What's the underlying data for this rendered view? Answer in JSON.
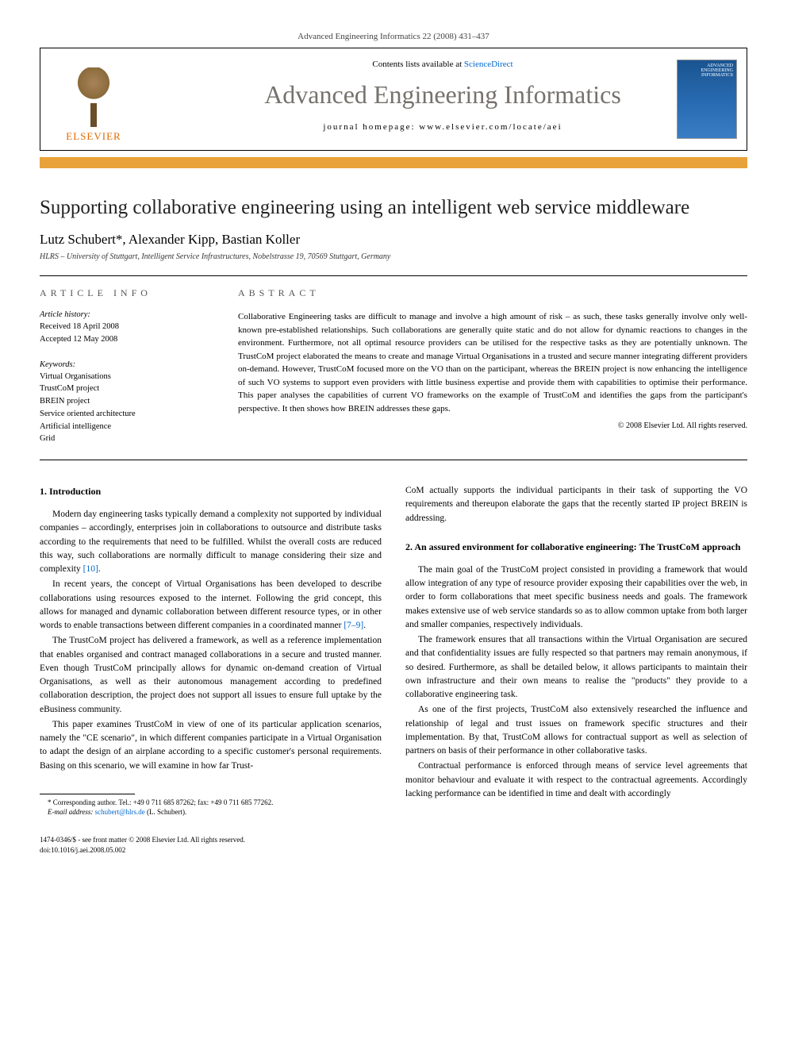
{
  "citation": "Advanced Engineering Informatics 22 (2008) 431–437",
  "header_box": {
    "contents_prefix": "Contents lists available at ",
    "sciencedirect": "ScienceDirect",
    "journal": "Advanced Engineering Informatics",
    "homepage_prefix": "journal homepage: ",
    "homepage_url": "www.elsevier.com/locate/aei",
    "publisher": "ELSEVIER",
    "cover_label": "ADVANCED ENGINEERING INFORMATICS"
  },
  "article": {
    "title": "Supporting collaborative engineering using an intelligent web service middleware",
    "authors": "Lutz Schubert*, Alexander Kipp, Bastian Koller",
    "affiliation": "HLRS – University of Stuttgart, Intelligent Service Infrastructures, Nobelstrasse 19, 70569 Stuttgart, Germany"
  },
  "info": {
    "heading": "ARTICLE INFO",
    "history_label": "Article history:",
    "received": "Received 18 April 2008",
    "accepted": "Accepted 12 May 2008",
    "keywords_label": "Keywords:",
    "keywords": [
      "Virtual Organisations",
      "TrustCoM project",
      "BREIN project",
      "Service oriented architecture",
      "Artificial intelligence",
      "Grid"
    ]
  },
  "abstract": {
    "heading": "ABSTRACT",
    "text": "Collaborative Engineering tasks are difficult to manage and involve a high amount of risk – as such, these tasks generally involve only well-known pre-established relationships. Such collaborations are generally quite static and do not allow for dynamic reactions to changes in the environment. Furthermore, not all optimal resource providers can be utilised for the respective tasks as they are potentially unknown. The TrustCoM project elaborated the means to create and manage Virtual Organisations in a trusted and secure manner integrating different providers on-demand. However, TrustCoM focused more on the VO than on the participant, whereas the BREIN project is now enhancing the intelligence of such VO systems to support even providers with little business expertise and provide them with capabilities to optimise their performance. This paper analyses the capabilities of current VO frameworks on the example of TrustCoM and identifies the gaps from the participant's perspective. It then shows how BREIN addresses these gaps.",
    "copyright": "© 2008 Elsevier Ltd. All rights reserved."
  },
  "sections": {
    "s1": {
      "heading": "1. Introduction",
      "p1a": "Modern day engineering tasks typically demand a complexity not supported by individual companies – accordingly, enterprises join in collaborations to outsource and distribute tasks according to the requirements that need to be fulfilled. Whilst the overall costs are reduced this way, such collaborations are normally difficult to manage considering their size and complexity ",
      "p1_ref": "[10]",
      "p1b": ".",
      "p2a": "In recent years, the concept of Virtual Organisations has been developed to describe collaborations using resources exposed to the internet. Following the grid concept, this allows for managed and dynamic collaboration between different resource types, or in other words to enable transactions between different companies in a coordinated manner ",
      "p2_ref": "[7–9]",
      "p2b": ".",
      "p3": "The TrustCoM project has delivered a framework, as well as a reference implementation that enables organised and contract managed collaborations in a secure and trusted manner. Even though TrustCoM principally allows for dynamic on-demand creation of Virtual Organisations, as well as their autonomous management according to predefined collaboration description, the project does not support all issues to ensure full uptake by the eBusiness community.",
      "p4": "This paper examines TrustCoM in view of one of its particular application scenarios, namely the \"CE scenario\", in which different companies participate in a Virtual Organisation to adapt the design of an airplane according to a specific customer's personal requirements. Basing on this scenario, we will examine in how far Trust-",
      "p4_cont": "CoM actually supports the individual participants in their task of supporting the VO requirements and thereupon elaborate the gaps that the recently started IP project BREIN is addressing."
    },
    "s2": {
      "heading": "2. An assured environment for collaborative engineering: The TrustCoM approach",
      "p1": "The main goal of the TrustCoM project consisted in providing a framework that would allow integration of any type of resource provider exposing their capabilities over the web, in order to form collaborations that meet specific business needs and goals. The framework makes extensive use of web service standards so as to allow common uptake from both larger and smaller companies, respectively individuals.",
      "p2": "The framework ensures that all transactions within the Virtual Organisation are secured and that confidentiality issues are fully respected so that partners may remain anonymous, if so desired. Furthermore, as shall be detailed below, it allows participants to maintain their own infrastructure and their own means to realise the \"products\" they provide to a collaborative engineering task.",
      "p3": "As one of the first projects, TrustCoM also extensively researched the influence and relationship of legal and trust issues on framework specific structures and their implementation. By that, TrustCoM allows for contractual support as well as selection of partners on basis of their performance in other collaborative tasks.",
      "p4": "Contractual performance is enforced through means of service level agreements that monitor behaviour and evaluate it with respect to the contractual agreements. Accordingly lacking performance can be identified in time and dealt with accordingly"
    }
  },
  "footnote": {
    "corr_label": "* Corresponding author. Tel.: +49 0 711 685 87262; fax: +49 0 711 685 77262.",
    "email_label": "E-mail address: ",
    "email": "schubert@hlrs.de",
    "email_suffix": " (L. Schubert)."
  },
  "bottom": {
    "issn": "1474-0346/$ - see front matter © 2008 Elsevier Ltd. All rights reserved.",
    "doi": "doi:10.1016/j.aei.2008.05.002"
  }
}
